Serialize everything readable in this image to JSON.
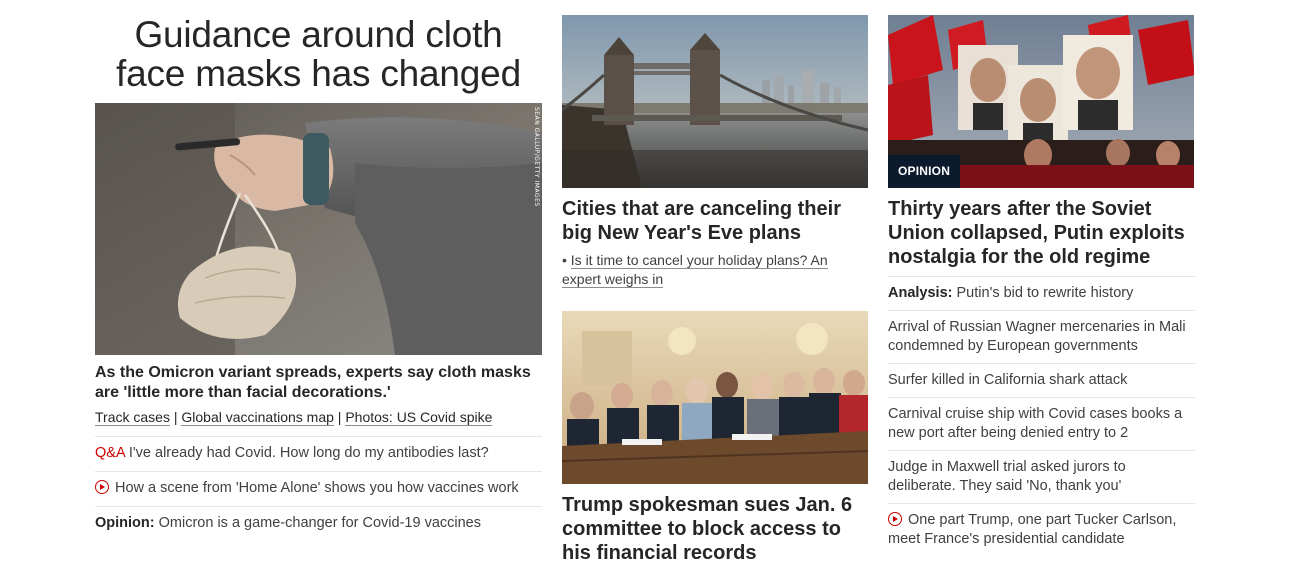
{
  "left": {
    "headline": "Guidance around cloth face masks has changed",
    "image_credit": "SEAN GALLUP/GETTY IMAGES",
    "subhead": "As the Omicron variant spreads, experts say cloth masks are 'little more than facial decorations.'",
    "links": [
      "Track cases",
      "Global vaccinations map",
      "Photos: US Covid spike"
    ],
    "separator": "|",
    "items": [
      {
        "kicker": "Q&A",
        "text": "I've already had Covid. How long do my antibodies last?"
      },
      {
        "kicker": "",
        "text": "How a scene from 'Home Alone' shows you how vaccines work",
        "icon": "play-circle-icon"
      },
      {
        "kicker": "Opinion:",
        "text": "Omicron is a game-changer for Covid-19 vaccines"
      }
    ]
  },
  "middle": {
    "card1": {
      "title": "Cities that are canceling their big New Year's Eve plans",
      "bullet_marker": "•",
      "bullet": "Is it time to cancel your holiday plans? An expert weighs in"
    },
    "card2": {
      "title": "Trump spokesman sues Jan. 6 committee to block access to his financial records"
    }
  },
  "right": {
    "badge": "OPINION",
    "title": "Thirty years after the Soviet Union collapsed, Putin exploits nostalgia for the old regime",
    "items": [
      {
        "kicker": "Analysis:",
        "text": "Putin's bid to rewrite history"
      },
      {
        "kicker": "",
        "text": "Arrival of Russian Wagner mercenaries in Mali condemned by European governments"
      },
      {
        "kicker": "",
        "text": "Surfer killed in California shark attack"
      },
      {
        "kicker": "",
        "text": "Carnival cruise ship with Covid cases books a new port after being denied entry to 2"
      },
      {
        "kicker": "",
        "text": "Judge in Maxwell trial asked jurors to deliberate. They said 'No, thank you'"
      },
      {
        "kicker": "",
        "text": "One part Trump, one part Tucker Carlson, meet France's presidential candidate",
        "icon": "play-circle-icon"
      }
    ]
  },
  "colors": {
    "accent_red": "#cc0000",
    "text": "#262626",
    "opinion_badge": "#0c1a2e",
    "divider": "#e6e6e6"
  }
}
